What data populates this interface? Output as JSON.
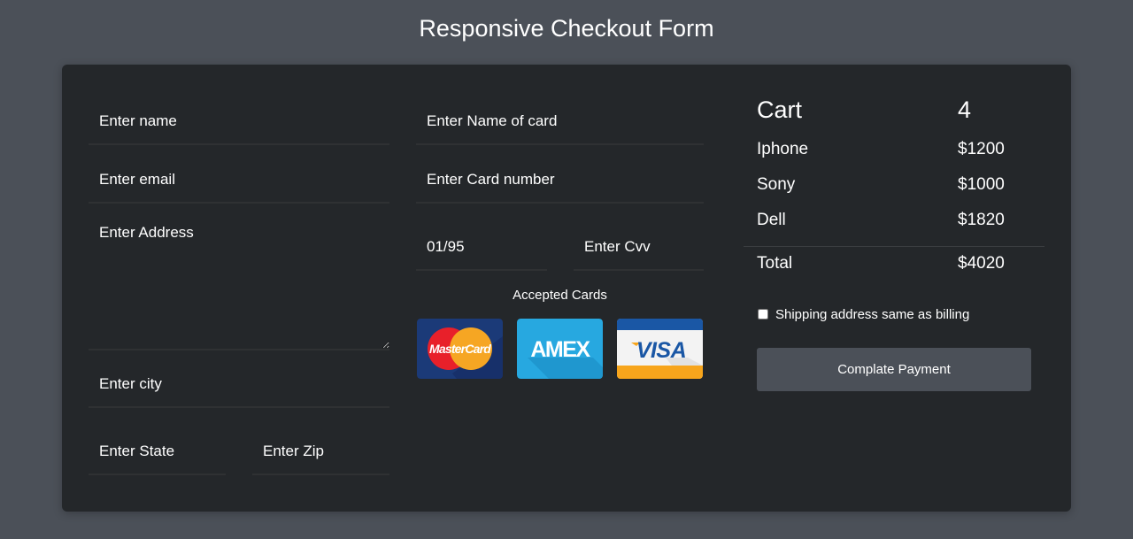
{
  "page": {
    "title": "Responsive Checkout Form"
  },
  "billing": {
    "name_placeholder": "Enter name",
    "email_placeholder": "Enter email",
    "address_placeholder": "Enter Address",
    "city_placeholder": "Enter city",
    "state_placeholder": "Enter State",
    "zip_placeholder": "Enter Zip"
  },
  "payment": {
    "card_name_placeholder": "Enter Name of card",
    "card_number_placeholder": "Enter Card number",
    "expiry_value": "01/95",
    "cvv_placeholder": "Enter Cvv",
    "accepted_cards_label": "Accepted Cards",
    "accepted_cards": [
      {
        "name": "MasterCard",
        "icon": "mastercard-logo-icon",
        "color": "#1a3a7a"
      },
      {
        "name": "AMEX",
        "icon": "amex-logo-icon",
        "color": "#26a5de"
      },
      {
        "name": "VISA",
        "icon": "visa-logo-icon",
        "color": "#1a57a5"
      }
    ]
  },
  "cart": {
    "title": "Cart",
    "count": "4",
    "items": [
      {
        "name": "Iphone",
        "price": "$1200"
      },
      {
        "name": "Sony",
        "price": "$1000"
      },
      {
        "name": "Dell",
        "price": "$1820"
      }
    ],
    "total_label": "Total",
    "total_value": "$4020",
    "shipping_checkbox_label": "Shipping address same as billing",
    "shipping_checked": false,
    "pay_button_label": "Complate Payment"
  },
  "colors": {
    "page_background": "#4b5058",
    "card_background": "#24272a",
    "button_background": "#4b5058",
    "text": "#ffffff"
  }
}
